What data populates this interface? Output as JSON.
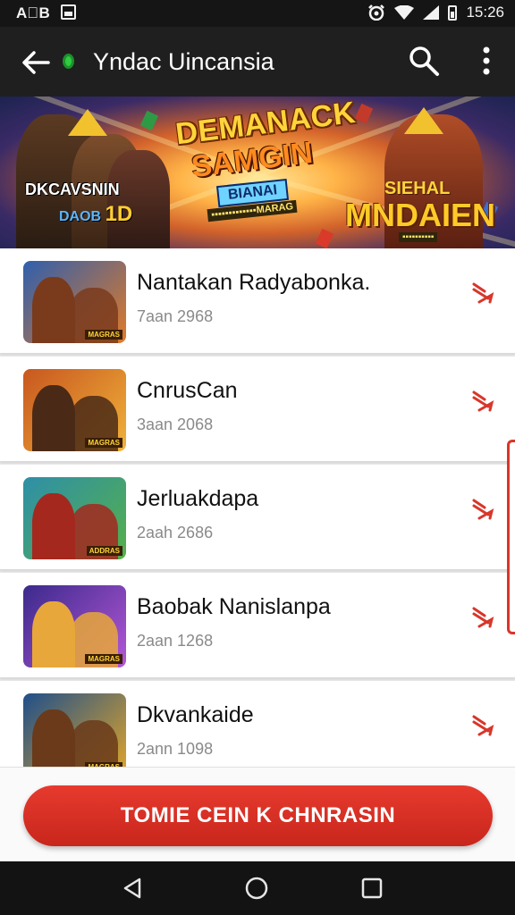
{
  "status_bar": {
    "left_text": "A⃝B",
    "time": "15:26"
  },
  "app_bar": {
    "title": "Yndaс Uincansia"
  },
  "banner": {
    "headline_1": "DEMANACK",
    "headline_2": "SAMGIN",
    "tag": "BIANAI",
    "strip": "▪▪▪▪▪▪▪▪▪▪▪▪▪MARAG",
    "left_title": "DKCAVSNIN",
    "left_sub": "DAOB",
    "left_badge": "1D",
    "right_title": "SIEHAL",
    "right_big": "MNDAIEN",
    "right_strip": "▪▪▪▪▪▪▪▪▪▪"
  },
  "items": [
    {
      "name": "Nantakan Radyabоnka.",
      "date": "7aan 2968",
      "thumb_caption": "MAGRAS",
      "thumb_colors": [
        "#2f5fae",
        "#e07a28",
        "#7a3b1c"
      ]
    },
    {
      "name": "CnrusCan",
      "date": "3aan 2068",
      "thumb_caption": "MAGRAS",
      "thumb_colors": [
        "#c8571f",
        "#f0b23a",
        "#4a2a16"
      ]
    },
    {
      "name": "Jerluakdapa",
      "date": "2aah 2686",
      "thumb_caption": "ADDRAS",
      "thumb_colors": [
        "#2e8fa8",
        "#55b04a",
        "#a5281e"
      ]
    },
    {
      "name": "Baobak Nanislanpa",
      "date": "2aan 1268",
      "thumb_caption": "MAGRAS",
      "thumb_colors": [
        "#3b2a8c",
        "#b457d6",
        "#e8a73a"
      ]
    },
    {
      "name": "Dkvankaide",
      "date": "2ann 1098",
      "thumb_caption": "MAGRAS",
      "thumb_colors": [
        "#1f4f8a",
        "#e0a52a",
        "#6a3a1a"
      ]
    }
  ],
  "cta": {
    "label": "TOMIE CEIN K CHNRASIN"
  },
  "colors": {
    "accent": "#d8362a",
    "appbar": "#1f1f1f",
    "status": "#151515"
  }
}
